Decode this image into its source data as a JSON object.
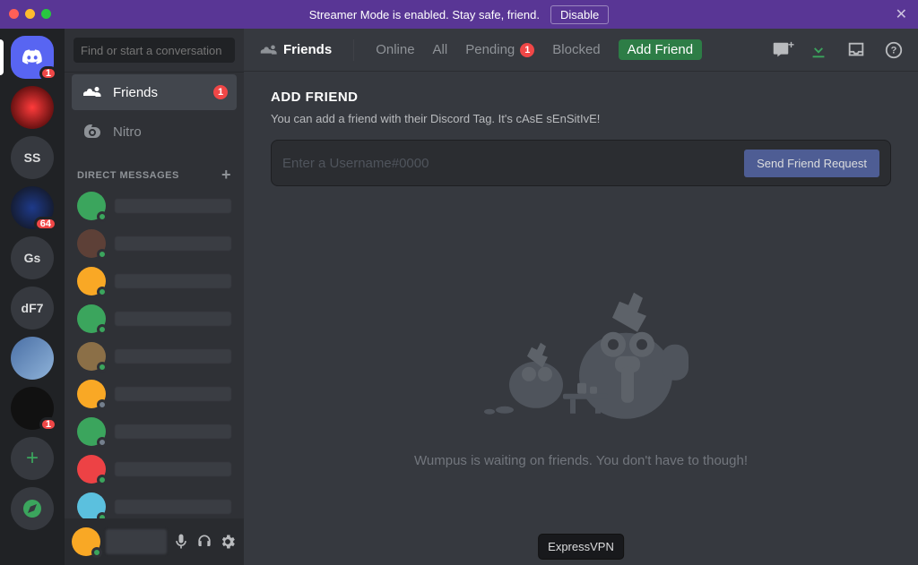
{
  "banner": {
    "text": "Streamer Mode is enabled. Stay safe, friend.",
    "disable": "Disable"
  },
  "guilds": {
    "home_badge": "1",
    "items": [
      {
        "label": "",
        "badge": "1",
        "cls": "black"
      },
      {
        "label": "",
        "badge": "",
        "cls": "crystal"
      },
      {
        "label": "dF7",
        "badge": "",
        "cls": ""
      },
      {
        "label": "Gs",
        "badge": "",
        "cls": ""
      },
      {
        "label": "",
        "badge": "64",
        "cls": "primetime"
      },
      {
        "label": "SS",
        "badge": "",
        "cls": ""
      },
      {
        "label": "",
        "badge": "",
        "cls": "redflare"
      }
    ]
  },
  "sidebar": {
    "search_placeholder": "Find or start a conversation",
    "friends": "Friends",
    "friends_badge": "1",
    "nitro": "Nitro",
    "dm_header": "DIRECT MESSAGES",
    "dms": [
      {
        "bg": "#3ba55d",
        "status": "#3ba55d"
      },
      {
        "bg": "#5d4037",
        "status": "#3ba55d"
      },
      {
        "bg": "#f9a825",
        "status": "#3ba55d"
      },
      {
        "bg": "#3ba55d",
        "status": "#3ba55d"
      },
      {
        "bg": "#8b6f47",
        "status": "#3ba55d"
      },
      {
        "bg": "#f9a825",
        "status": "#747f8d"
      },
      {
        "bg": "#3ba55d",
        "status": "#747f8d"
      },
      {
        "bg": "#ed4245",
        "status": "#3ba55d"
      },
      {
        "bg": "#5bc0de",
        "status": "#3ba55d"
      }
    ],
    "me_avatar": "#f9a825"
  },
  "topbar": {
    "label": "Friends",
    "tabs": {
      "online": "Online",
      "all": "All",
      "pending": "Pending",
      "pending_badge": "1",
      "blocked": "Blocked",
      "add": "Add Friend"
    }
  },
  "content": {
    "title": "ADD FRIEND",
    "subtitle": "You can add a friend with their Discord Tag. It's cAsE sEnSitIvE!",
    "input_placeholder": "Enter a Username#0000",
    "send": "Send Friend Request",
    "empty": "Wumpus is waiting on friends. You don't have to though!",
    "tooltip": "ExpressVPN"
  }
}
